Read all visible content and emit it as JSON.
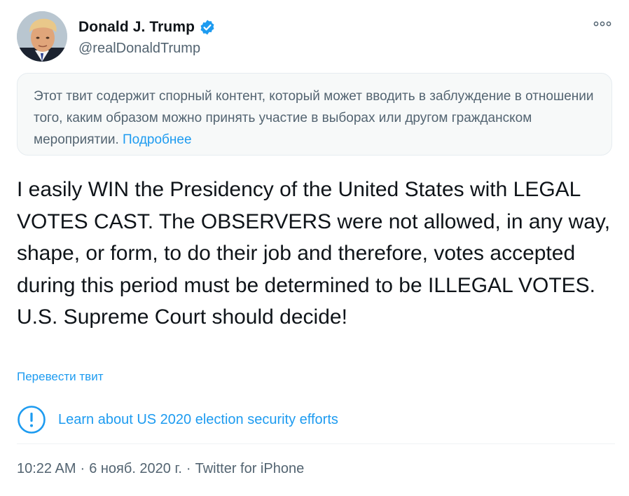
{
  "author": {
    "display_name": "Donald J. Trump",
    "handle": "@realDonaldTrump",
    "verified_icon": "verified-badge-icon",
    "avatar_icon": "profile-photo"
  },
  "more_icon": "more-options-icon",
  "notice": {
    "text": "Этот твит содержит спорный контент, который может вводить в заблуждение в отношении того, каким образом можно принять участие в выборах или другом гражданском мероприятии.",
    "link": "Подробнее"
  },
  "tweet": {
    "text": "I easily WIN the Presidency of the United States with LEGAL VOTES CAST. The OBSERVERS were not allowed, in any way, shape, or form, to do their job and therefore, votes accepted during this period must be determined to be ILLEGAL VOTES. U.S. Supreme Court should decide!"
  },
  "translate_label": "Перевести твит",
  "election_notice": {
    "icon": "exclamation-circle-icon",
    "label": "Learn about US 2020 election security efforts"
  },
  "meta": {
    "time": "10:22 AM",
    "separator": "·",
    "date": "6 нояб. 2020 г.",
    "source": "Twitter for iPhone"
  },
  "colors": {
    "accent": "#1d9bf0",
    "secondary_text": "#536471",
    "notice_bg": "#f7f9f9"
  }
}
